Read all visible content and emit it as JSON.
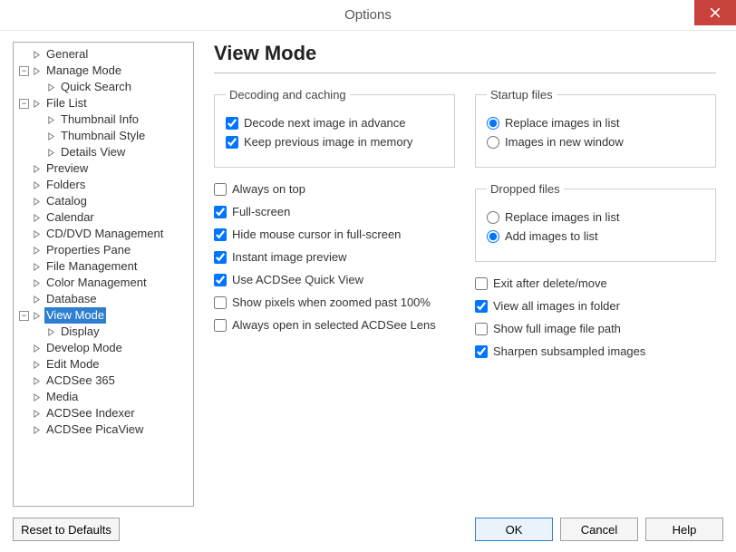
{
  "title": "Options",
  "tree": [
    {
      "label": "General",
      "depth": 0,
      "exp": null
    },
    {
      "label": "Manage Mode",
      "depth": 0,
      "exp": "-"
    },
    {
      "label": "Quick Search",
      "depth": 1,
      "exp": null
    },
    {
      "label": "File List",
      "depth": 0,
      "exp": "-"
    },
    {
      "label": "Thumbnail Info",
      "depth": 1,
      "exp": null
    },
    {
      "label": "Thumbnail Style",
      "depth": 1,
      "exp": null
    },
    {
      "label": "Details View",
      "depth": 1,
      "exp": null
    },
    {
      "label": "Preview",
      "depth": 0,
      "exp": null
    },
    {
      "label": "Folders",
      "depth": 0,
      "exp": null
    },
    {
      "label": "Catalog",
      "depth": 0,
      "exp": null
    },
    {
      "label": "Calendar",
      "depth": 0,
      "exp": null
    },
    {
      "label": "CD/DVD Management",
      "depth": 0,
      "exp": null
    },
    {
      "label": "Properties Pane",
      "depth": 0,
      "exp": null
    },
    {
      "label": "File Management",
      "depth": 0,
      "exp": null
    },
    {
      "label": "Color Management",
      "depth": 0,
      "exp": null
    },
    {
      "label": "Database",
      "depth": 0,
      "exp": null
    },
    {
      "label": "View Mode",
      "depth": 0,
      "exp": "-",
      "selected": true
    },
    {
      "label": "Display",
      "depth": 1,
      "exp": null
    },
    {
      "label": "Develop Mode",
      "depth": 0,
      "exp": null
    },
    {
      "label": "Edit Mode",
      "depth": 0,
      "exp": null
    },
    {
      "label": "ACDSee 365",
      "depth": 0,
      "exp": null
    },
    {
      "label": "Media",
      "depth": 0,
      "exp": null
    },
    {
      "label": "ACDSee Indexer",
      "depth": 0,
      "exp": null
    },
    {
      "label": "ACDSee PicaView",
      "depth": 0,
      "exp": null
    }
  ],
  "page": {
    "heading": "View Mode",
    "group_decoding": "Decoding and caching",
    "chk_decode_next": "Decode next image in advance",
    "chk_keep_prev": "Keep previous image in memory",
    "chk_always_top": "Always on top",
    "chk_fullscreen": "Full-screen",
    "chk_hide_cursor": "Hide mouse cursor in full-screen",
    "chk_instant_preview": "Instant image preview",
    "chk_quick_view": "Use ACDSee Quick View",
    "chk_show_pixels": "Show pixels when zoomed past 100%",
    "chk_always_lens": "Always open in selected ACDSee Lens",
    "group_startup": "Startup files",
    "rad_startup_replace": "Replace images in list",
    "rad_startup_new": "Images in new window",
    "group_dropped": "Dropped files",
    "rad_drop_replace": "Replace images in list",
    "rad_drop_add": "Add images to list",
    "chk_exit_after": "Exit after delete/move",
    "chk_view_all": "View all images in folder",
    "chk_show_path": "Show full image file path",
    "chk_sharpen": "Sharpen subsampled images"
  },
  "buttons": {
    "reset": "Reset to Defaults",
    "ok": "OK",
    "cancel": "Cancel",
    "help": "Help"
  }
}
